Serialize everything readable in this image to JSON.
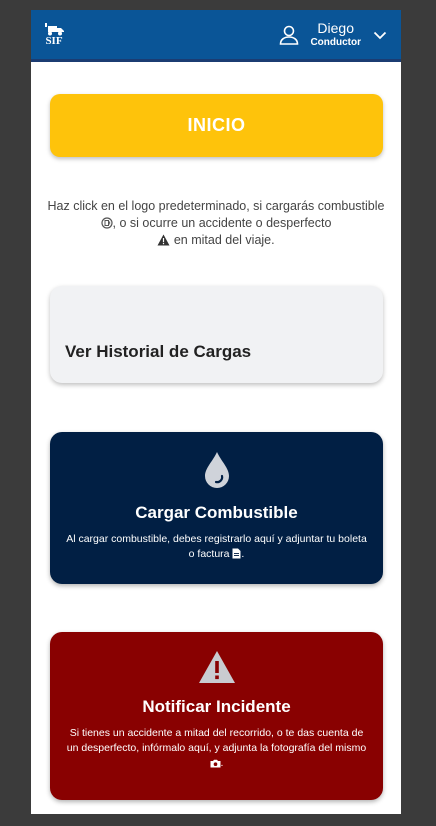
{
  "header": {
    "logo_text": "SIF",
    "user_name": "Diego",
    "user_role": "Conductor"
  },
  "inicio_button": {
    "label": "INICIO"
  },
  "instructions": {
    "part1": "Haz click en el logo predeterminado, si cargarás combustible",
    "part2": ", o si ocurre un accidente o desperfecto",
    "part3": "en mitad del viaje."
  },
  "history_card": {
    "title": "Ver Historial de Cargas"
  },
  "fuel_card": {
    "title": "Cargar Combustible",
    "description": "Al cargar combustible, debes registrarlo aquí y adjuntar tu boleta o factura",
    "description_end": "."
  },
  "incident_card": {
    "title": "Notificar Incidente",
    "description": "Si tienes un accidente a mitad del recorrido, o te das cuenta de un desperfecto, infórmalo aquí, y adjunta la fotografía del mismo",
    "description_end": "."
  },
  "colors": {
    "header": "#0a5597",
    "inicio": "#fec30b",
    "fuel_card": "#011f44",
    "incident_card": "#890101",
    "history_card": "#f1f2f4"
  },
  "icons": [
    "truck-icon",
    "user-icon",
    "chevron-down-icon",
    "fuel-pump-icon",
    "warning-icon",
    "drop-icon",
    "document-icon",
    "camera-icon"
  ]
}
